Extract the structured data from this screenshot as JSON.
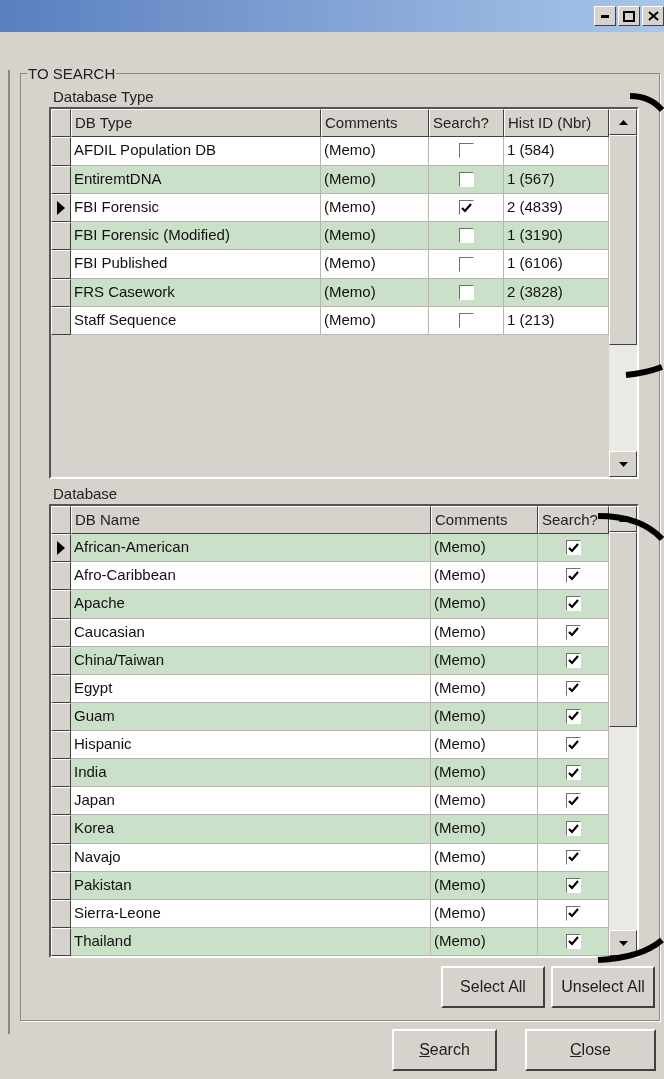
{
  "window": {
    "controls": [
      {
        "kind": "minimize"
      },
      {
        "kind": "maximize"
      },
      {
        "kind": "close"
      }
    ]
  },
  "group": {
    "title": "TO SEARCH"
  },
  "db_type": {
    "label": "Database Type",
    "columns": [
      "DB Type",
      "Comments",
      "Search?",
      "Hist ID (Nbr)"
    ],
    "rows": [
      {
        "name": "AFDIL Population DB",
        "comments": "(Memo)",
        "search": false,
        "hist": "1 (584)",
        "selected": false
      },
      {
        "name": "EntiremtDNA",
        "comments": "(Memo)",
        "search": false,
        "hist": "1 (567)",
        "selected": false
      },
      {
        "name": "FBI Forensic",
        "comments": "(Memo)",
        "search": true,
        "hist": "2 (4839)",
        "selected": true
      },
      {
        "name": "FBI Forensic (Modified)",
        "comments": "(Memo)",
        "search": false,
        "hist": "1 (3190)",
        "selected": false
      },
      {
        "name": "FBI Published",
        "comments": "(Memo)",
        "search": false,
        "hist": "1 (6106)",
        "selected": false
      },
      {
        "name": "FRS Casework",
        "comments": "(Memo)",
        "search": false,
        "hist": "2 (3828)",
        "selected": false
      },
      {
        "name": "Staff Sequence",
        "comments": "(Memo)",
        "search": false,
        "hist": "1 (213)",
        "selected": false
      }
    ]
  },
  "database": {
    "label": "Database",
    "columns": [
      "DB Name",
      "Comments",
      "Search?"
    ],
    "rows": [
      {
        "name": "African-American",
        "comments": "(Memo)",
        "search": true,
        "selected": true
      },
      {
        "name": "Afro-Caribbean",
        "comments": "(Memo)",
        "search": true,
        "selected": false
      },
      {
        "name": "Apache",
        "comments": "(Memo)",
        "search": true,
        "selected": false
      },
      {
        "name": "Caucasian",
        "comments": "(Memo)",
        "search": true,
        "selected": false
      },
      {
        "name": "China/Taiwan",
        "comments": "(Memo)",
        "search": true,
        "selected": false
      },
      {
        "name": "Egypt",
        "comments": "(Memo)",
        "search": true,
        "selected": false
      },
      {
        "name": "Guam",
        "comments": "(Memo)",
        "search": true,
        "selected": false
      },
      {
        "name": "Hispanic",
        "comments": "(Memo)",
        "search": true,
        "selected": false
      },
      {
        "name": "India",
        "comments": "(Memo)",
        "search": true,
        "selected": false
      },
      {
        "name": "Japan",
        "comments": "(Memo)",
        "search": true,
        "selected": false
      },
      {
        "name": "Korea",
        "comments": "(Memo)",
        "search": true,
        "selected": false
      },
      {
        "name": "Navajo",
        "comments": "(Memo)",
        "search": true,
        "selected": false
      },
      {
        "name": "Pakistan",
        "comments": "(Memo)",
        "search": true,
        "selected": false
      },
      {
        "name": "Sierra-Leone",
        "comments": "(Memo)",
        "search": true,
        "selected": false
      },
      {
        "name": "Thailand",
        "comments": "(Memo)",
        "search": true,
        "selected": false
      }
    ]
  },
  "grid_buttons": [
    {
      "label": "Select All"
    },
    {
      "label": "Unselect All"
    }
  ],
  "buttons": [
    {
      "label": "Search",
      "underline_first": true
    },
    {
      "label": "Close",
      "underline_first": true
    }
  ]
}
